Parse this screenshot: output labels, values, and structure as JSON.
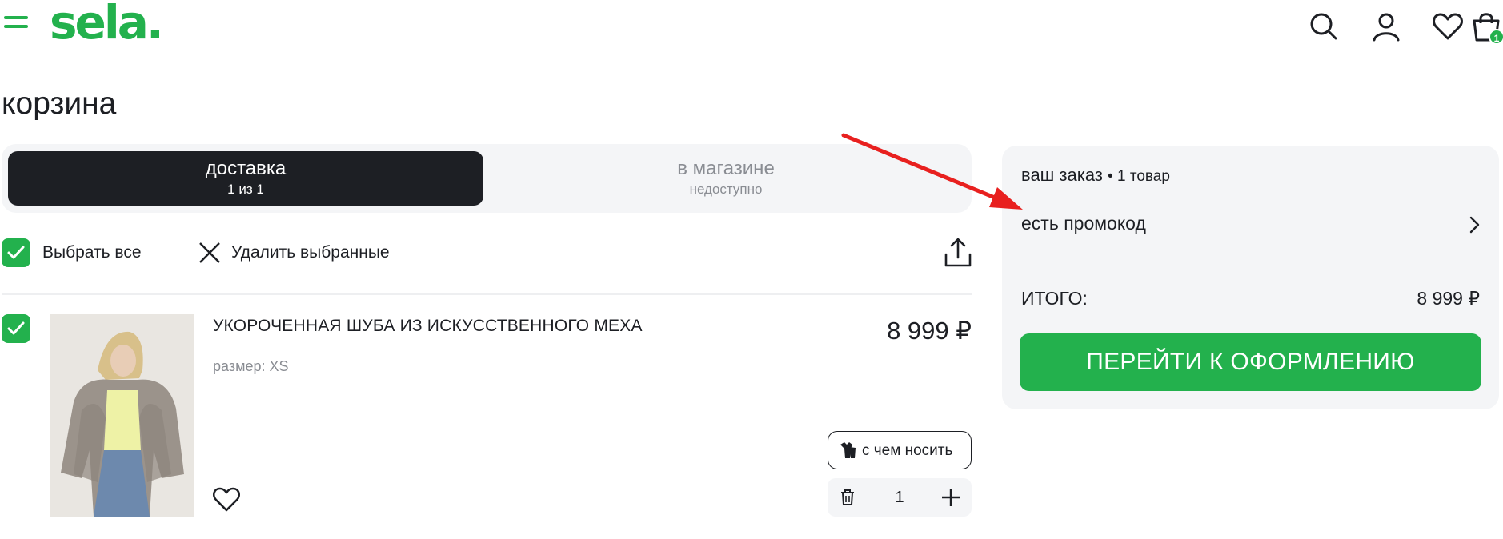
{
  "header": {
    "logo": "sela.",
    "cart_badge": "1",
    "colors": {
      "brand": "#23b14d",
      "dark": "#1d1f24",
      "muted": "#8a8d93",
      "panel": "#f4f5f7"
    },
    "icons": [
      "menu-icon",
      "search-icon",
      "user-icon",
      "heart-icon",
      "cart-icon"
    ]
  },
  "page": {
    "title": "корзина"
  },
  "tabs": [
    {
      "label": "доставка",
      "sub": "1 из 1",
      "active": true
    },
    {
      "label": "в магазине",
      "sub": "недоступно",
      "active": false
    }
  ],
  "actions": {
    "select_all": "Выбрать все",
    "delete_selected": "Удалить выбранные"
  },
  "product": {
    "name": "УКОРОЧЕННАЯ ШУБА ИЗ ИСКУССТВЕННОГО МЕХА",
    "size": "размер: XS",
    "price": "8 999 ₽",
    "wear_label": "с чем носить",
    "quantity": "1",
    "checked": true
  },
  "summary": {
    "title": "ваш заказ",
    "count": "• 1 товар",
    "promo": "есть промокод",
    "total_label": "ИТОГО:",
    "total_value": "8 999 ₽",
    "checkout": "ПЕРЕЙТИ К ОФОРМЛЕНИЮ"
  }
}
